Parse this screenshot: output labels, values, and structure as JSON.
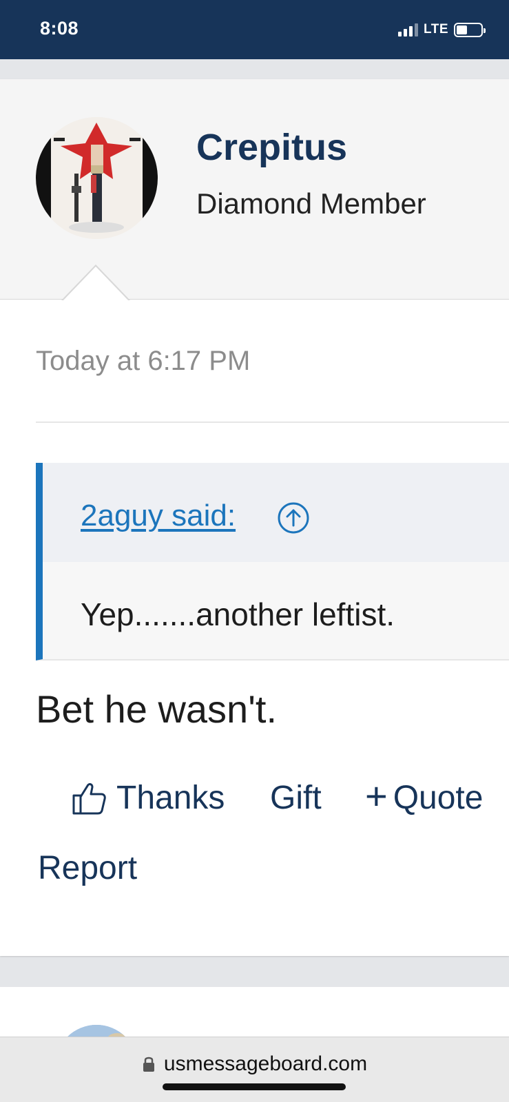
{
  "status_bar": {
    "time": "8:08",
    "network": "LTE",
    "battery_level": 0.45
  },
  "post": {
    "user": {
      "name": "Crepitus",
      "title": "Diamond Member"
    },
    "date": "Today at 6:17 PM",
    "quote": {
      "author": "2aguy said:",
      "text": "Yep.......another leftist."
    },
    "body": "Bet he wasn't.",
    "actions": {
      "thanks": "Thanks",
      "gift": "Gift",
      "quote": "Quote",
      "report": "Report"
    }
  },
  "browser": {
    "url": "usmessageboard.com"
  },
  "colors": {
    "header_bg": "#173459",
    "link_blue": "#1c75bc",
    "accent_navy": "#173459"
  }
}
